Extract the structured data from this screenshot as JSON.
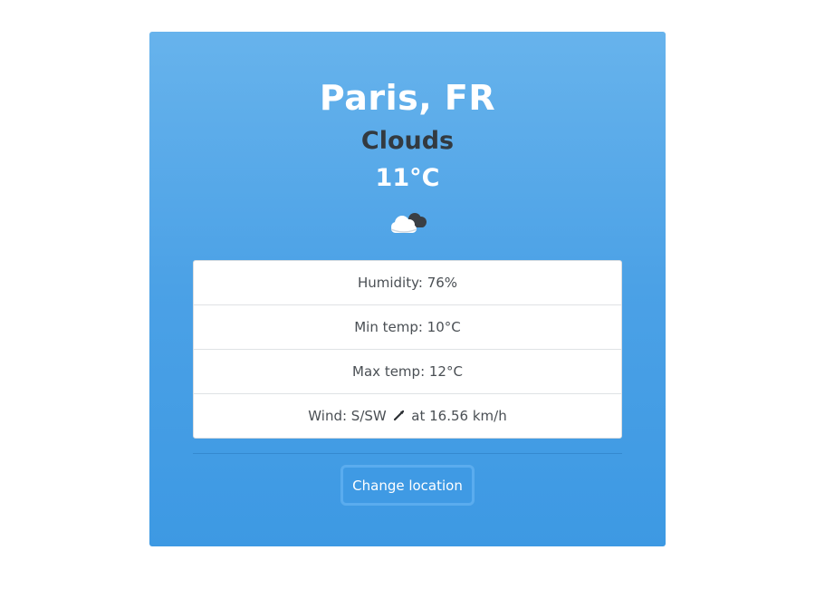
{
  "weather": {
    "location": "Paris, FR",
    "condition": "Clouds",
    "temperature": "11°C",
    "icon": "cloud-icon"
  },
  "details": {
    "humidity": "Humidity: 76%",
    "min_temp": "Min temp: 10°C",
    "max_temp": "Max temp: 12°C",
    "wind_prefix": "Wind: S/SW",
    "wind_icon": "wind-direction-arrow-icon",
    "wind_suffix": "at 16.56 km/h"
  },
  "actions": {
    "change_location_label": "Change location"
  },
  "colors": {
    "card_gradient_top": "#67b3ec",
    "card_gradient_bottom": "#3d99e3",
    "condition_text": "#333a40",
    "detail_text": "#4a4f54"
  }
}
